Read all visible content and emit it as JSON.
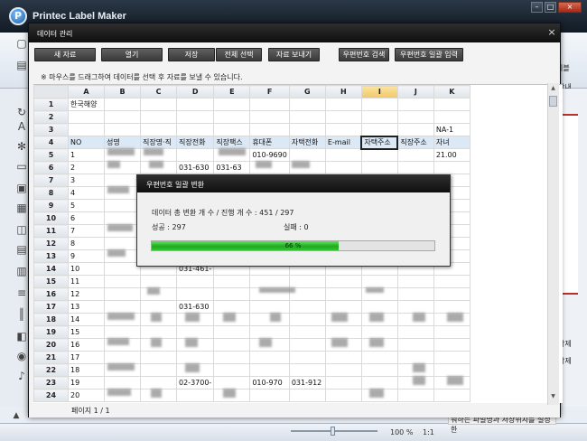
{
  "app": {
    "title": "Printec Label Maker",
    "logo_letter": "P",
    "ribbon_right_label": "이블",
    "right_panel_info": "간내",
    "right_delete_1": "삭제",
    "right_delete_2": "삭제",
    "right_k": "K",
    "status_hint": "워하는 파일명과 저장위치를 설정한",
    "zoom": "100 %",
    "zoom_ratio": "1:1",
    "left_tool_icons": [
      "document-icon",
      "text-icon",
      "snowflake-icon",
      "shape-icon",
      "image-icon",
      "barcode-icon",
      "grid-icon",
      "gallery-icon",
      "table-icon",
      "ruler-icon",
      "barcode2-icon",
      "database-icon",
      "globe-icon",
      "music-icon"
    ]
  },
  "dialog": {
    "title": "데이터 관리",
    "close_glyph": "×",
    "buttons": {
      "new": "새 자료",
      "open": "열기",
      "save": "저장",
      "select_all": "전체 선택",
      "send": "자료 보내기",
      "zip_search": "우편번호 검색",
      "zip_batch": "우편번호 일괄 입력"
    },
    "hint": "※ 마우스를 드래그하여 데이터를 선택 후 자료를 보낼 수 있습니다.",
    "page_info": "페이지 1 / 1"
  },
  "sheet": {
    "columns": [
      "A",
      "B",
      "C",
      "D",
      "E",
      "F",
      "G",
      "H",
      "I",
      "J",
      "K"
    ],
    "selected_column": "I",
    "rows": [
      {
        "n": "1",
        "cells": [
          "한국해양",
          "",
          "",
          "",
          "",
          "",
          "",
          "",
          "",
          "",
          ""
        ]
      },
      {
        "n": "2",
        "cells": [
          "",
          "",
          "",
          "",
          "",
          "",
          "",
          "",
          "",
          "",
          ""
        ]
      },
      {
        "n": "3",
        "cells": [
          "",
          "",
          "",
          "",
          "",
          "",
          "",
          "",
          "",
          "",
          "NA-1"
        ]
      },
      {
        "n": "4",
        "cells": [
          "NO",
          "성명",
          "직장명·직",
          "직장전화",
          "직장팩스",
          "휴대폰",
          "자택전화",
          "E-mail",
          "자택주소",
          "직장주소",
          "자녀"
        ]
      },
      {
        "n": "5",
        "cells": [
          "1",
          "",
          "",
          "",
          "",
          "010-9690",
          "",
          "",
          "",
          "",
          "21.00"
        ]
      },
      {
        "n": "6",
        "cells": [
          "2",
          "",
          "",
          "031-630",
          "031-63",
          "",
          "",
          "",
          "",
          "",
          ""
        ]
      },
      {
        "n": "7",
        "cells": [
          "3",
          "",
          "",
          "",
          "",
          "",
          "",
          "",
          "",
          "",
          ""
        ]
      },
      {
        "n": "8",
        "cells": [
          "4",
          "",
          "",
          "",
          "",
          "",
          "",
          "",
          "",
          "",
          ""
        ]
      },
      {
        "n": "9",
        "cells": [
          "5",
          "",
          "",
          "",
          "",
          "",
          "",
          "",
          "",
          "",
          ""
        ]
      },
      {
        "n": "10",
        "cells": [
          "6",
          "",
          "",
          "",
          "",
          "",
          "",
          "",
          "",
          "",
          ""
        ]
      },
      {
        "n": "11",
        "cells": [
          "7",
          "",
          "",
          "",
          "",
          "",
          "",
          "",
          "",
          "",
          ""
        ]
      },
      {
        "n": "12",
        "cells": [
          "8",
          "",
          "",
          "",
          "",
          "",
          "",
          "",
          "",
          "",
          ""
        ]
      },
      {
        "n": "13",
        "cells": [
          "9",
          "",
          "",
          "",
          "",
          "",
          "",
          "",
          "",
          "",
          ""
        ]
      },
      {
        "n": "14",
        "cells": [
          "10",
          "",
          "",
          "031-461-",
          "",
          "",
          "",
          "",
          "",
          "",
          ""
        ]
      },
      {
        "n": "15",
        "cells": [
          "11",
          "",
          "",
          "",
          "",
          "",
          "",
          "",
          "",
          "",
          ""
        ]
      },
      {
        "n": "16",
        "cells": [
          "12",
          "",
          "",
          "",
          "",
          "",
          "",
          "",
          "",
          "",
          ""
        ]
      },
      {
        "n": "17",
        "cells": [
          "13",
          "",
          "",
          "031-630",
          "",
          "",
          "",
          "",
          "",
          "",
          ""
        ]
      },
      {
        "n": "18",
        "cells": [
          "14",
          "",
          "",
          "",
          "",
          "",
          "",
          "",
          "",
          "",
          ""
        ]
      },
      {
        "n": "19",
        "cells": [
          "15",
          "",
          "",
          "",
          "",
          "",
          "",
          "",
          "",
          "",
          ""
        ]
      },
      {
        "n": "20",
        "cells": [
          "16",
          "",
          "",
          "",
          "",
          "",
          "",
          "",
          "",
          "",
          ""
        ]
      },
      {
        "n": "21",
        "cells": [
          "17",
          "",
          "",
          "",
          "",
          "",
          "",
          "",
          "",
          "",
          ""
        ]
      },
      {
        "n": "22",
        "cells": [
          "18",
          "",
          "",
          "",
          "",
          "",
          "",
          "",
          "",
          "",
          ""
        ]
      },
      {
        "n": "23",
        "cells": [
          "19",
          "",
          "",
          "02-3700-",
          "",
          "010-970",
          "031-912",
          "",
          "",
          "",
          ""
        ]
      },
      {
        "n": "24",
        "cells": [
          "20",
          "",
          "",
          "",
          "",
          "",
          "",
          "",
          "",
          "",
          ""
        ]
      }
    ]
  },
  "modal": {
    "title": "우편번호 일괄 변환",
    "total_label": "데이터 총 변환 개 수 / 진행 개 수 :",
    "total_value": "451 / 297",
    "success_label": "성공 :",
    "success_value": "297",
    "fail_label": "실패 :",
    "fail_value": "0",
    "progress_percent": 66,
    "progress_text": "66 %",
    "progress_color": "#22b322"
  }
}
